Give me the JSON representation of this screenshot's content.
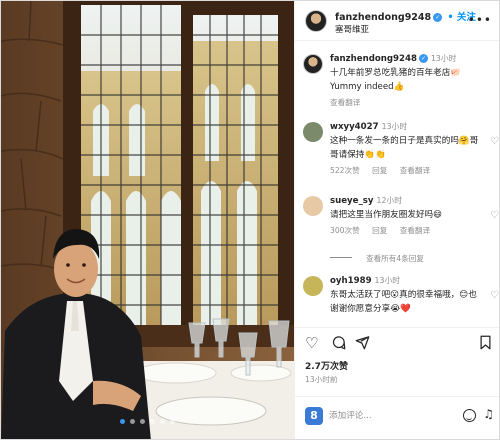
{
  "post": {
    "author": "fanzhendong9248",
    "follow_label": "• 关注",
    "location": "塞哥维亚",
    "more_label": "•••",
    "verified_glyph": "✓"
  },
  "caption": {
    "username": "fanzhendong9248",
    "time": "13小时",
    "text": "十几年前罗总吃乳猪的百年老店🐖 Yummy indeed👍",
    "translate": "查看翻译"
  },
  "comments": [
    {
      "username": "wxyy4027",
      "time": "13小时",
      "text": "这种一条发一条的日子是真实的吗🤗哥哥请保持👏👏",
      "likes": "522次赞",
      "reply": "回复",
      "translate": "查看翻译",
      "avatar_color": "#7a8a6b"
    },
    {
      "username": "sueye_sy",
      "time": "12小时",
      "text": "请把这里当作朋友圈发好吗😄",
      "likes": "300次赞",
      "reply": "回复",
      "translate": "查看翻译",
      "avatar_color": "#e8c9a5"
    },
    {
      "username": "oyh1989",
      "time": "13小时",
      "text": "东哥太活跃了吧😮真的很幸福哦，😊也谢谢你愿意分享😭❤️",
      "avatar_color": "#c7b55a"
    }
  ],
  "view_all_replies": "查看所有4条回复",
  "actions": {
    "like_icon": "heart-icon",
    "comment_icon": "comment-icon",
    "share_icon": "share-icon",
    "save_icon": "bookmark-icon"
  },
  "likes_count": "2.7万次赞",
  "post_date": "13小时前",
  "composer": {
    "placeholder": "添加评论...",
    "emoji_label": "8",
    "gif_label": "♫"
  },
  "carousel": {
    "total": 6,
    "active": 0
  },
  "colors": {
    "accent": "#0095f6",
    "verified": "#3897f0",
    "heart_red": "#ed4956",
    "muted": "#8e8e8e"
  }
}
